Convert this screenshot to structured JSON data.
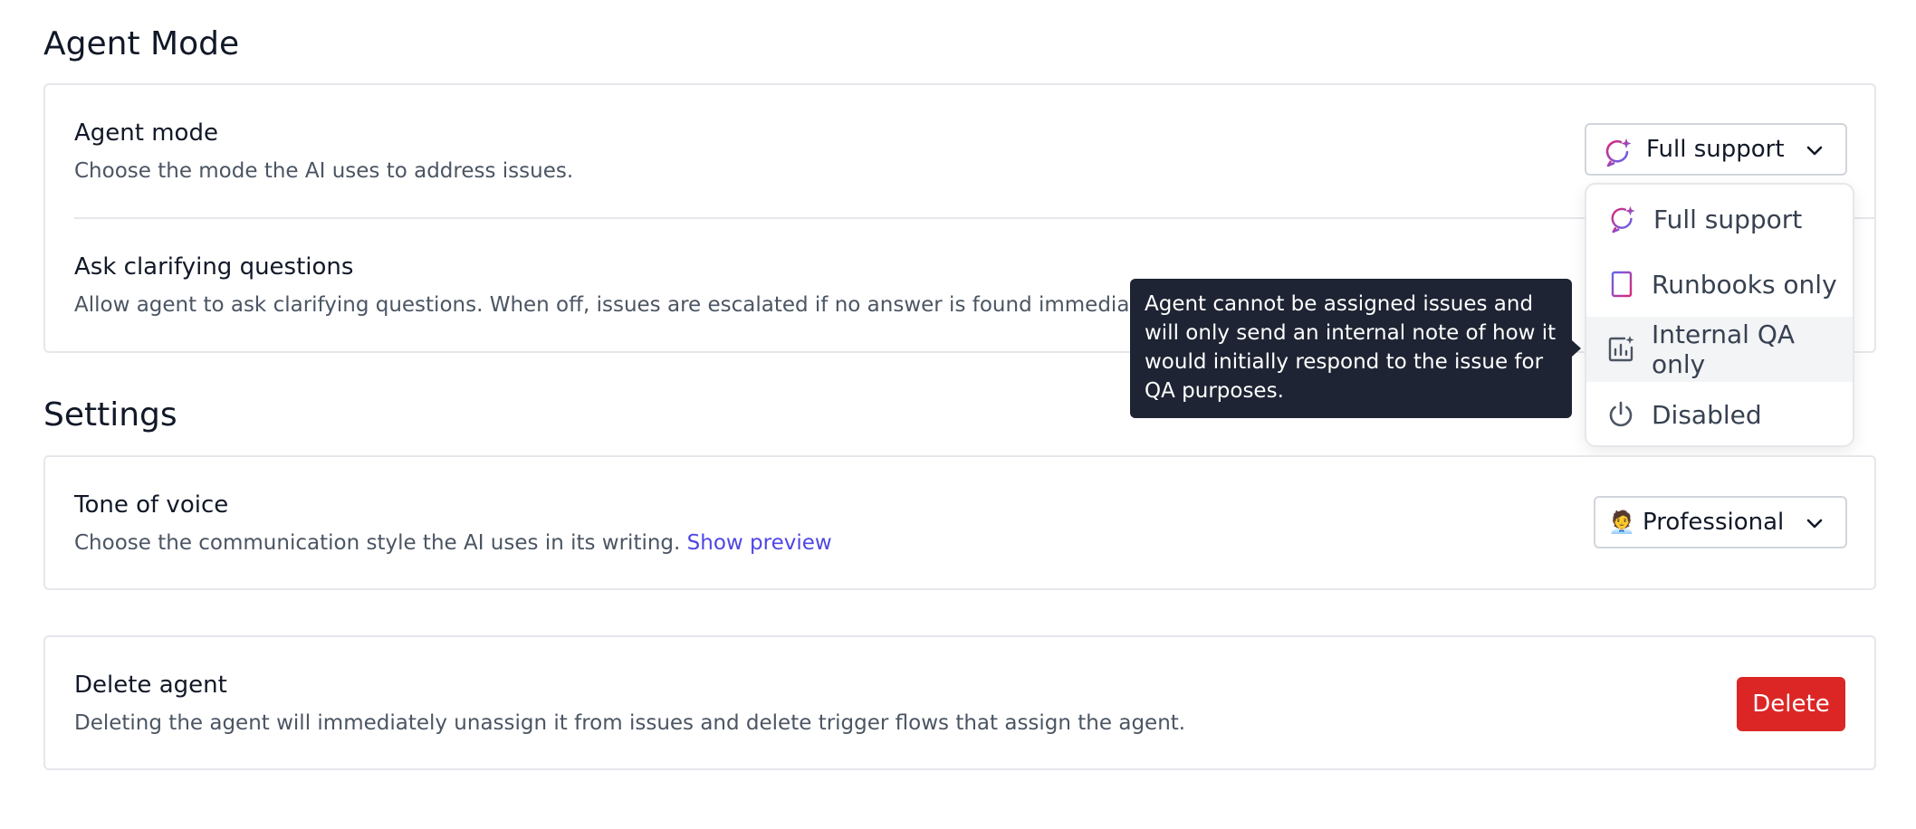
{
  "sections": {
    "agent_mode_title": "Agent Mode",
    "settings_title": "Settings"
  },
  "agent_mode": {
    "title": "Agent mode",
    "description": "Choose the mode the AI uses to address issues.",
    "selected": "Full support",
    "options": [
      {
        "label": "Full support",
        "icon": "sparkle-chat-icon"
      },
      {
        "label": "Runbooks only",
        "icon": "notebook-icon"
      },
      {
        "label": "Internal QA only",
        "icon": "chart-sparkle-icon"
      },
      {
        "label": "Disabled",
        "icon": "power-icon"
      }
    ],
    "tooltip": "Agent cannot be assigned issues and will only send an internal note of how it would initially respond to the issue for QA purposes."
  },
  "clarifying": {
    "title": "Ask clarifying questions",
    "description": "Allow agent to ask clarifying questions. When off, issues are escalated if no answer is found immediately."
  },
  "tone": {
    "title": "Tone of voice",
    "description": "Choose the communication style the AI uses in its writing.",
    "link": "Show preview",
    "emoji": "🧑‍💼",
    "selected": "Professional"
  },
  "delete_agent": {
    "title": "Delete agent",
    "description": "Deleting the agent will immediately unassign it from issues and delete trigger flows that assign the agent.",
    "button": "Delete"
  },
  "colors": {
    "accent": "#4f46e5",
    "danger": "#dc2626",
    "tooltip_bg": "#1e2433",
    "sparkle_gradient": [
      "#db2777",
      "#6366f1"
    ]
  }
}
